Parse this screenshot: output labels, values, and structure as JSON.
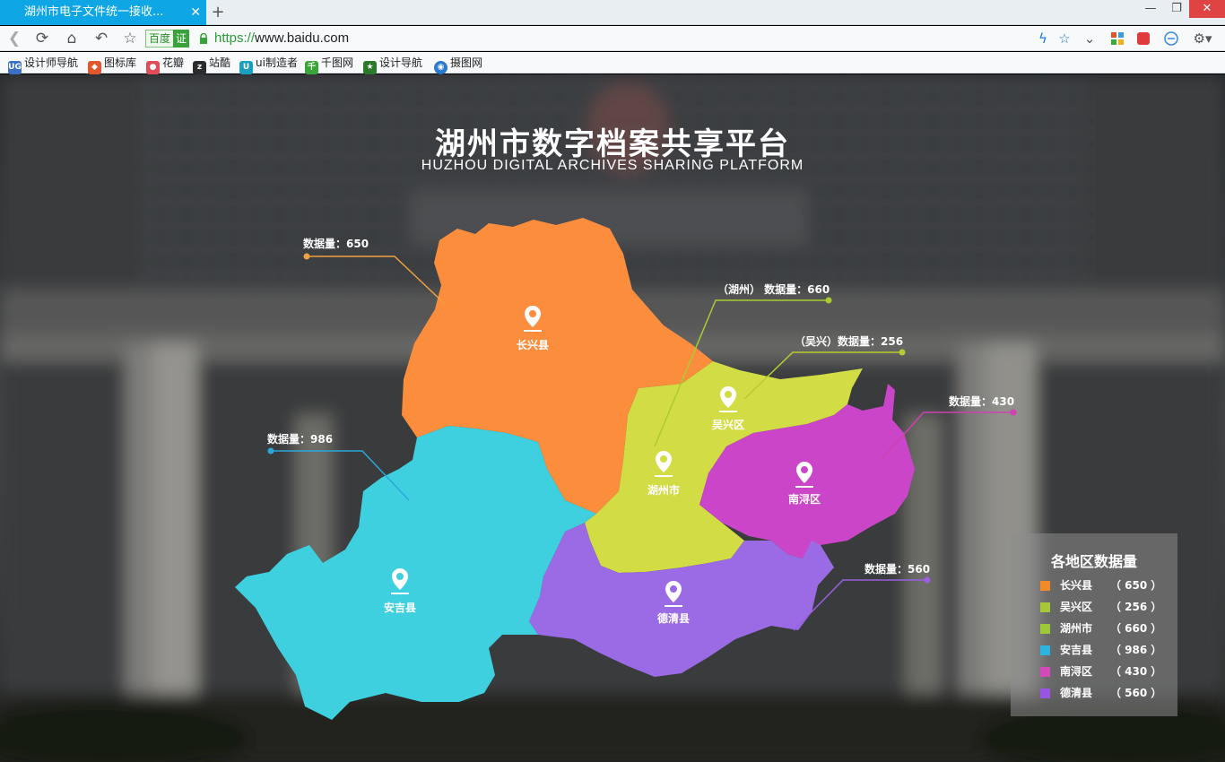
{
  "browser": {
    "tab_title": "湖州市电子文件统一接收...",
    "new_tab_label": "+",
    "url_scheme": "https://",
    "url_host": "www.baidu.com",
    "search_badge": "百度",
    "cert_badge": "证",
    "bookmarks": [
      {
        "label": "设计师导航",
        "icon": "ug-icon",
        "color": "#3a6fc8"
      },
      {
        "label": "图标库",
        "icon": "iconlib-icon",
        "color": "#e2572b"
      },
      {
        "label": "花瓣",
        "icon": "huaban-icon",
        "color": "#e34b57"
      },
      {
        "label": "站酷",
        "icon": "zcool-icon",
        "color": "#2b2b2b"
      },
      {
        "label": "ui制造者",
        "icon": "uimaker-icon",
        "color": "#19a0c0"
      },
      {
        "label": "千图网",
        "icon": "qiantu-icon",
        "color": "#3aa63a"
      },
      {
        "label": "设计导航",
        "icon": "shield-icon",
        "color": "#2a7a2a"
      },
      {
        "label": "摄图网",
        "icon": "sheting-icon",
        "color": "#2a7ad0"
      }
    ]
  },
  "page": {
    "title_cn": "湖州市数字档案共享平台",
    "title_en": "HUZHOU DIGITAL ARCHIVES SHARING PLATFORM"
  },
  "regions": [
    {
      "id": "changxing",
      "name": "长兴县",
      "color": "#fc8d3c",
      "callout": "数据量：650"
    },
    {
      "id": "wuxing",
      "name": "吴兴区",
      "color": "#d2dc45",
      "callout": "（吴兴）数据量：256"
    },
    {
      "id": "huzhou",
      "name": "湖州市",
      "color": "#d2dc45",
      "callout": "（湖州） 数据量：660"
    },
    {
      "id": "anji",
      "name": "安吉县",
      "color": "#3fd0e0",
      "callout": "数据量：986"
    },
    {
      "id": "nanxun",
      "name": "南浔区",
      "color": "#cb45c8",
      "callout": "数据量：430"
    },
    {
      "id": "deqing",
      "name": "德清县",
      "color": "#9b6be6",
      "callout": "数据量：560"
    }
  ],
  "legend": {
    "title": "各地区数据量",
    "items": [
      {
        "name": "长兴县",
        "value": "（ 650 ）",
        "color": "#f08a2a"
      },
      {
        "name": "吴兴区",
        "value": "（ 256 ）",
        "color": "#a8c63a"
      },
      {
        "name": "湖州市",
        "value": "（ 660 ）",
        "color": "#9cc83a"
      },
      {
        "name": "安吉县",
        "value": "（ 986 ）",
        "color": "#2fb2dc"
      },
      {
        "name": "南浔区",
        "value": "（ 430 ）",
        "color": "#d24ab8"
      },
      {
        "name": "德清县",
        "value": "（ 560 ）",
        "color": "#9a54e4"
      }
    ]
  },
  "callout_colors": {
    "changxing": "#f0a040",
    "huzhou": "#a8cc30",
    "wuxing": "#b8cc30",
    "anji": "#2aa8dc",
    "nanxun": "#d040b0",
    "deqing": "#9a60e0"
  }
}
